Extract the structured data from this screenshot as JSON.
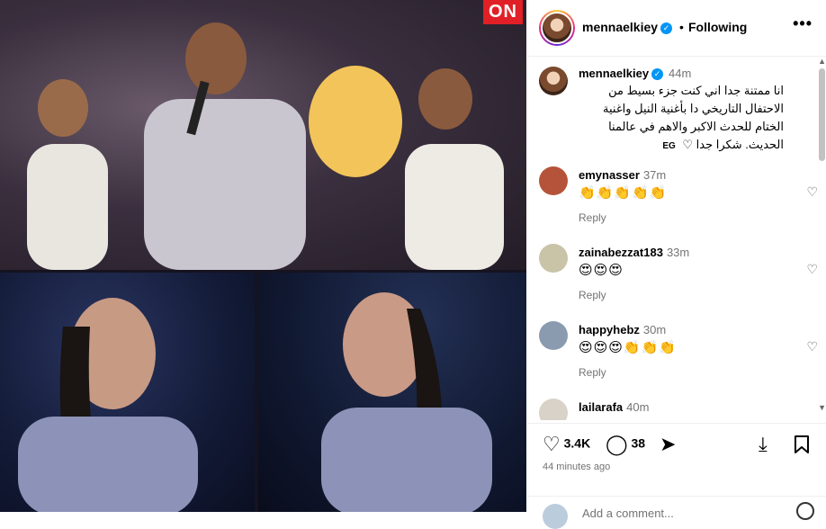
{
  "header": {
    "username": "mennaelkiey",
    "follow_status": "Following",
    "separator": "•",
    "more_glyph": "•••"
  },
  "media": {
    "channel_logo": "ON"
  },
  "caption": {
    "username": "mennaelkiey",
    "time": "44m",
    "text": "انا ممتنة جدا اني كنت جزء بسيط من الاحتفال التاريخي دا بأغنية النيل واغنية الختام للحدث الاكبر والاهم في عالمنا الحديث. شكرا جدا ♡",
    "tag": "EG"
  },
  "comments": [
    {
      "username": "emynasser",
      "time": "37m",
      "text": "👏👏👏👏👏",
      "reply": "Reply",
      "avatar_color": "#b5533a"
    },
    {
      "username": "zainabezzat183",
      "time": "33m",
      "text": "😍😍😍",
      "reply": "Reply",
      "avatar_color": "#c9c3a8"
    },
    {
      "username": "happyhebz",
      "time": "30m",
      "text": "😍😍😍👏👏👏",
      "reply": "Reply",
      "avatar_color": "#8a9bb0"
    },
    {
      "username": "lailarafa",
      "time": "40m",
      "text": "",
      "reply": "",
      "avatar_color": "#d8d2c8"
    }
  ],
  "actions": {
    "likes": "3.4K",
    "comments": "38",
    "posted": "44 minutes ago",
    "add_comment_placeholder": "Add a comment..."
  },
  "icons": {
    "heart": "♡",
    "comment": "◯",
    "share": "➤",
    "save": "🔖",
    "download": "⤓"
  },
  "colors": {
    "verified": "#0095f6",
    "channel_logo": "#e01f26",
    "muted_text": "#737373"
  }
}
